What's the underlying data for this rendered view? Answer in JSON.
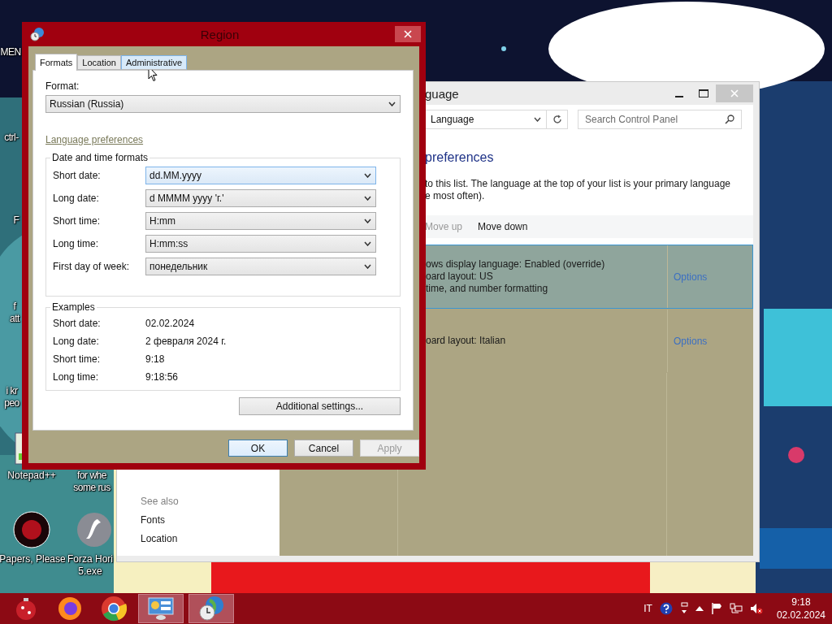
{
  "desktop": {
    "icons": [
      {
        "kind": "cut",
        "lines": [
          "MEN"
        ]
      },
      {
        "kind": "cut",
        "lines": [
          "ctrl-"
        ]
      },
      {
        "kind": "cut",
        "lines": [
          "F"
        ]
      },
      {
        "kind": "cut",
        "lines": [
          "f",
          "att"
        ]
      },
      {
        "kind": "cut",
        "lines": [
          "i kr",
          "peo"
        ]
      },
      {
        "kind": "document",
        "lines": [
          "Notepad++"
        ]
      },
      {
        "kind": "cut",
        "lines": [
          "for whe",
          "some rus"
        ]
      },
      {
        "kind": "badge",
        "lines": [
          "Papers, Please"
        ]
      },
      {
        "kind": "disc",
        "lines": [
          "Forza Hori",
          "5.exe"
        ]
      }
    ]
  },
  "control_panel": {
    "title": "guage",
    "address": "Language",
    "search": {
      "placeholder": "Search Control Panel"
    },
    "heading": "preferences",
    "description": [
      "to this list. The language at the top of your list is your primary language",
      "e most often)."
    ],
    "toolbar": [
      {
        "label": "Move up",
        "disabled": true
      },
      {
        "label": "Move down",
        "disabled": false
      }
    ],
    "languages": [
      {
        "lines": [
          "ows display language: Enabled (override)",
          "oard layout: US",
          "time, and number formatting"
        ],
        "options": "Options",
        "selected": true
      },
      {
        "lines": [
          "oard layout: Italian"
        ],
        "options": "Options",
        "selected": false
      }
    ],
    "see_also": {
      "title": "See also",
      "links": [
        "Fonts",
        "Location"
      ]
    }
  },
  "region_dialog": {
    "title": "Region",
    "tabs": [
      {
        "label": "Formats",
        "selected": true,
        "hovered": false
      },
      {
        "label": "Location",
        "selected": false,
        "hovered": false
      },
      {
        "label": "Administrative",
        "selected": false,
        "hovered": true
      }
    ],
    "format": {
      "label": "Format:",
      "value": "Russian (Russia)"
    },
    "language_link": "Language preferences",
    "formats": {
      "title": "Date and time formats",
      "rows": [
        {
          "label": "Short date:",
          "value": "dd.MM.yyyy",
          "focused": true
        },
        {
          "label": "Long date:",
          "value": "d MMMM yyyy 'г.'",
          "focused": false
        },
        {
          "label": "Short time:",
          "value": "H:mm",
          "focused": false
        },
        {
          "label": "Long time:",
          "value": "H:mm:ss",
          "focused": false
        },
        {
          "label": "First day of week:",
          "value": "понедельник",
          "focused": false
        }
      ]
    },
    "examples": {
      "title": "Examples",
      "rows": [
        {
          "label": "Short date:",
          "value": "02.02.2024"
        },
        {
          "label": "Long date:",
          "value": "2 февраля 2024 г."
        },
        {
          "label": "Short time:",
          "value": "9:18"
        },
        {
          "label": "Long time:",
          "value": "9:18:56"
        }
      ]
    },
    "additional": "Additional settings...",
    "buttons": [
      {
        "label": "OK",
        "default": true,
        "disabled": false
      },
      {
        "label": "Cancel",
        "default": false,
        "disabled": false
      },
      {
        "label": "Apply",
        "default": false,
        "disabled": true
      }
    ]
  },
  "taskbar": {
    "apps": [
      {
        "kind": "ornament",
        "active": false
      },
      {
        "kind": "fox",
        "active": false
      },
      {
        "kind": "wheel",
        "active": false
      },
      {
        "kind": "panel",
        "active": true
      },
      {
        "kind": "globe-clock",
        "active": true
      }
    ],
    "tray": {
      "language": "IT",
      "time": "9:18",
      "date": "02.02.2024"
    }
  }
}
